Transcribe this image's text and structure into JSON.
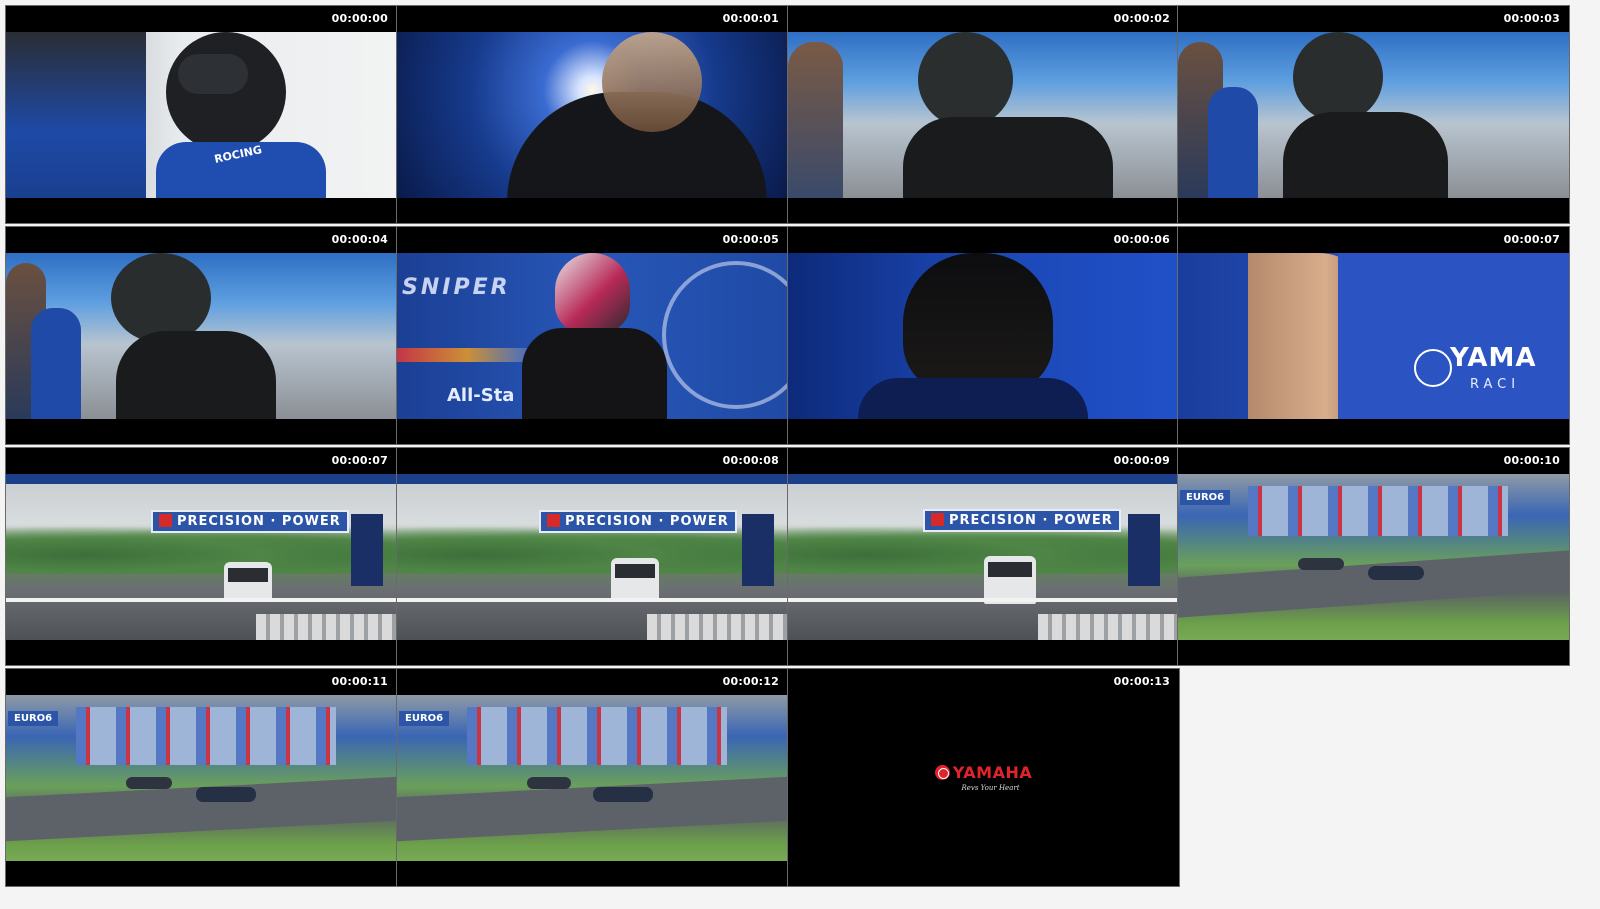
{
  "thumbnails": [
    {
      "timestamp": "00:00:00",
      "scene": "rider-helmet"
    },
    {
      "timestamp": "00:00:01",
      "scene": "backlit-rider"
    },
    {
      "timestamp": "00:00:02",
      "scene": "paddock-rider"
    },
    {
      "timestamp": "00:00:03",
      "scene": "paddock-rider"
    },
    {
      "timestamp": "00:00:04",
      "scene": "paddock-rider"
    },
    {
      "timestamp": "00:00:05",
      "scene": "pink-helmet-rider"
    },
    {
      "timestamp": "00:00:06",
      "scene": "backlit-man"
    },
    {
      "timestamp": "00:00:07",
      "scene": "yamaha-jersey"
    },
    {
      "timestamp": "00:00:07",
      "scene": "track-van"
    },
    {
      "timestamp": "00:00:08",
      "scene": "track-van"
    },
    {
      "timestamp": "00:00:09",
      "scene": "track-van"
    },
    {
      "timestamp": "00:00:10",
      "scene": "crash-grass"
    },
    {
      "timestamp": "00:00:11",
      "scene": "crash-grass"
    },
    {
      "timestamp": "00:00:12",
      "scene": "crash-grass"
    },
    {
      "timestamp": "00:00:13",
      "scene": "end-card"
    }
  ],
  "scene_text": {
    "helmet_brand": "ROCING",
    "banner_precision": "PRECISION · POWER",
    "banner_sniper": "SNIPER",
    "banner_allstar": "All-Sta",
    "jersey_brand": "YAMA",
    "jersey_sub": "RACI",
    "euro_sign": "EURO6",
    "logo_brand": "YAMAHA",
    "logo_tagline": "Revs Your Heart"
  }
}
